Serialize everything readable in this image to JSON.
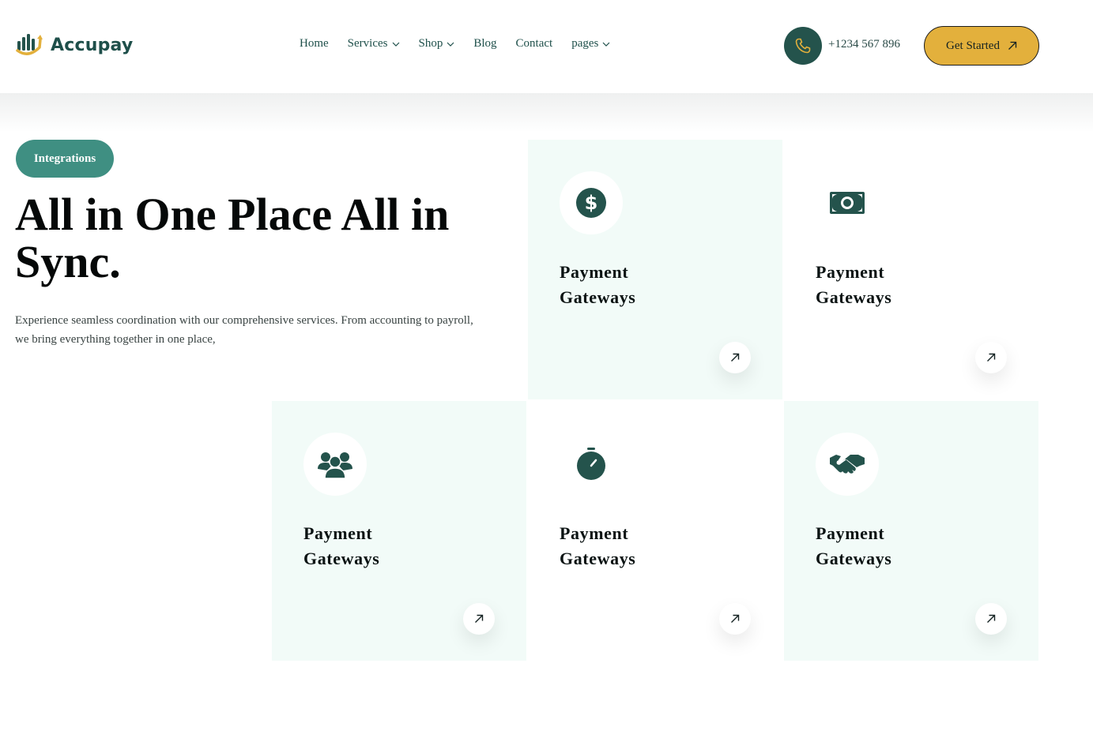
{
  "brand": {
    "name": "Accupay"
  },
  "nav": [
    {
      "label": "Home",
      "dropdown": false
    },
    {
      "label": "Services",
      "dropdown": true
    },
    {
      "label": "Shop",
      "dropdown": true
    },
    {
      "label": "Blog",
      "dropdown": false
    },
    {
      "label": "Contact",
      "dropdown": false
    },
    {
      "label": "pages",
      "dropdown": true
    }
  ],
  "header": {
    "phone": "+1234 567 896",
    "cta_label": "Get Started"
  },
  "hero": {
    "badge": "Integrations",
    "title": "All in One Place All in Sync.",
    "description": "Experience seamless coordination with our comprehensive services. From accounting to payroll, we bring everything together in one place,"
  },
  "cards": [
    {
      "title": "Payment Gateways",
      "icon": "dollar-coin-icon"
    },
    {
      "title": "Payment Gateways",
      "icon": "money-bill-icon"
    },
    {
      "title": "Payment Gateways",
      "icon": "users-icon"
    },
    {
      "title": "Payment Gateways",
      "icon": "stopwatch-icon"
    },
    {
      "title": "Payment Gateways",
      "icon": "handshake-icon"
    }
  ],
  "colors": {
    "primary": "#24534c",
    "accent": "#e3b03c",
    "badge": "#3f8f82",
    "card_tint": "#f2fbf8"
  }
}
